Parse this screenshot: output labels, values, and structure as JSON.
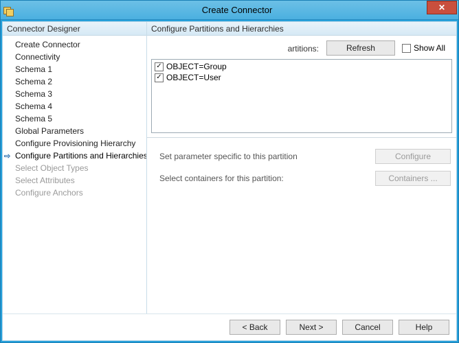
{
  "window": {
    "title": "Create Connector"
  },
  "sidebar": {
    "header": "Connector Designer",
    "items": [
      {
        "label": "Create Connector",
        "state": "done"
      },
      {
        "label": "Connectivity",
        "state": "done"
      },
      {
        "label": "Schema 1",
        "state": "done"
      },
      {
        "label": "Schema 2",
        "state": "done"
      },
      {
        "label": "Schema 3",
        "state": "done"
      },
      {
        "label": "Schema 4",
        "state": "done"
      },
      {
        "label": "Schema 5",
        "state": "done"
      },
      {
        "label": "Global Parameters",
        "state": "done"
      },
      {
        "label": "Configure Provisioning Hierarchy",
        "state": "done"
      },
      {
        "label": "Configure Partitions and Hierarchies",
        "state": "current"
      },
      {
        "label": "Select Object Types",
        "state": "future"
      },
      {
        "label": "Select Attributes",
        "state": "future"
      },
      {
        "label": "Configure Anchors",
        "state": "future"
      }
    ]
  },
  "right": {
    "header": "Configure Partitions and Hierarchies",
    "partitions_label_fragment": "artitions:",
    "refresh_label": "Refresh",
    "show_all_label": "Show All",
    "show_all_checked": false,
    "partition_items": [
      {
        "checked": true,
        "label": "OBJECT=Group"
      },
      {
        "checked": true,
        "label": "OBJECT=User"
      }
    ],
    "set_param_label": "Set parameter specific to this partition",
    "configure_label": "Configure",
    "select_containers_label": "Select containers for this partition:",
    "containers_label": "Containers ..."
  },
  "footer": {
    "back": "<  Back",
    "next": "Next  >",
    "cancel": "Cancel",
    "help": "Help"
  }
}
